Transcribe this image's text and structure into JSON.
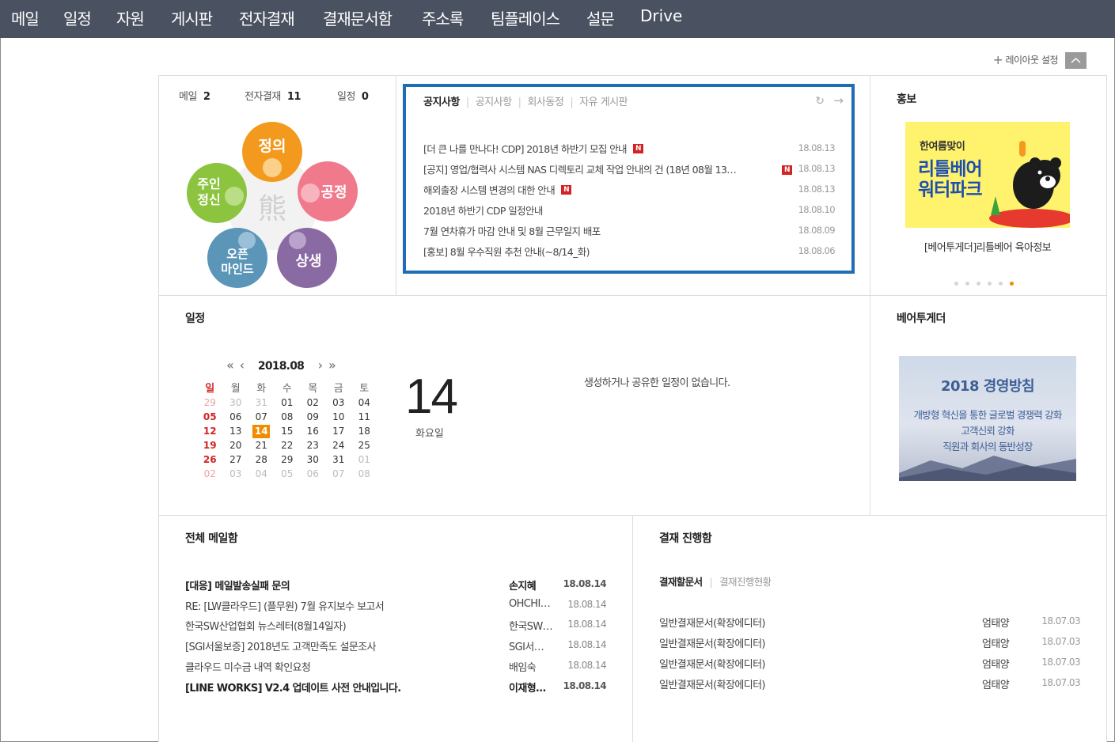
{
  "nav": [
    "메일",
    "일정",
    "자원",
    "게시판",
    "전자결재",
    "결재문서함",
    "주소록",
    "팀플레이스",
    "설문",
    "Drive"
  ],
  "layout_setting": "레이아웃 설정",
  "summary": [
    {
      "label": "메일",
      "count": "2"
    },
    {
      "label": "전자결재",
      "count": "11"
    },
    {
      "label": "일정",
      "count": "0"
    }
  ],
  "values": {
    "top": "정의",
    "left_line1": "주인",
    "left_line2": "정신",
    "right": "공정",
    "bottom_left_line1": "오픈",
    "bottom_left_line2": "마인드",
    "bottom_right": "상생",
    "center_logo": "熊"
  },
  "notice": {
    "tabs": [
      "공지사항",
      "공지사항",
      "회사동정",
      "자유 게시판"
    ],
    "badge": "N",
    "items": [
      {
        "title": "[더 큰 나를 만나다! CDP] 2018년 하반기 모집 안내",
        "date": "18.08.13",
        "new": true
      },
      {
        "title": "[공지] 영업/협력사 시스템 NAS 디렉토리 교체 작업 안내의 건 (18년 08월 13…",
        "date": "18.08.13",
        "new": true
      },
      {
        "title": "해외출장 시스템 변경의 대한 안내",
        "date": "18.08.13",
        "new": true
      },
      {
        "title": "2018년 하반기 CDP 일정안내",
        "date": "18.08.10",
        "new": false
      },
      {
        "title": "7월 연차휴가 마감 안내 및 8월 근무일지 배포",
        "date": "18.08.09",
        "new": false
      },
      {
        "title": "[홍보] 8월 우수직원 추천 안내(~8/14_화)",
        "date": "18.08.06",
        "new": false
      }
    ]
  },
  "promo": {
    "title": "홍보",
    "img_line1": "한여름맞이",
    "img_line2": "리틀베어",
    "img_line3": "워터파크",
    "caption": "[베어투게더]리틀베어 육아정보",
    "dots": 6,
    "active_dot": 5
  },
  "schedule": {
    "title": "일정",
    "month": "2018.08",
    "weekdays": [
      "일",
      "월",
      "화",
      "수",
      "목",
      "금",
      "토"
    ],
    "weeks": [
      [
        "29",
        "30",
        "31",
        "01",
        "02",
        "03",
        "04"
      ],
      [
        "05",
        "06",
        "07",
        "08",
        "09",
        "10",
        "11"
      ],
      [
        "12",
        "13",
        "14",
        "15",
        "16",
        "17",
        "18"
      ],
      [
        "19",
        "20",
        "21",
        "22",
        "23",
        "24",
        "25"
      ],
      [
        "26",
        "27",
        "28",
        "29",
        "30",
        "31",
        "01"
      ],
      [
        "02",
        "03",
        "04",
        "05",
        "06",
        "07",
        "08"
      ]
    ],
    "today": "14",
    "day_name": "화요일",
    "empty_message": "생성하거나 공유한 일정이 없습니다."
  },
  "bear_together": {
    "title": "베어투게더",
    "banner_title": "2018 경영방침",
    "lines": [
      "개방형 혁신을 통한 글로벌 경쟁력 강화",
      "고객신뢰 강화",
      "직원과 회사의 동반성장"
    ]
  },
  "mail": {
    "title": "전체 메일함",
    "items": [
      {
        "subject": "[대응] 메일발송실패 문의",
        "from": "손지혜",
        "date": "18.08.14",
        "unread": true
      },
      {
        "subject": "RE: [LW클라우드] (플무원) 7월 유지보수 보고서",
        "from": "OHCHI…",
        "date": "18.08.14",
        "unread": false
      },
      {
        "subject": "한국SW산업협회 뉴스레터(8월14일자)",
        "from": "한국SW…",
        "date": "18.08.14",
        "unread": false
      },
      {
        "subject": "[SGI서울보증] 2018년도 고객만족도 설문조사",
        "from": "SGI서…",
        "date": "18.08.14",
        "unread": false
      },
      {
        "subject": "클라우드 미수금 내역 확인요청",
        "from": "배임숙",
        "date": "18.08.14",
        "unread": false
      },
      {
        "subject": "[LINE WORKS] V2.4 업데이트 사전 안내입니다.",
        "from": "이재형…",
        "date": "18.08.14",
        "unread": true
      }
    ]
  },
  "approval": {
    "title": "결재 진행함",
    "tabs": [
      "결재할문서",
      "결재진행현황"
    ],
    "items": [
      {
        "doc": "일반결재문서(확장에디터)",
        "user": "엄태양",
        "date": "18.07.03"
      },
      {
        "doc": "일반결재문서(확장에디터)",
        "user": "엄태양",
        "date": "18.07.03"
      },
      {
        "doc": "일반결재문서(확장에디터)",
        "user": "엄태양",
        "date": "18.07.03"
      },
      {
        "doc": "일반결재문서(확장에디터)",
        "user": "엄태양",
        "date": "18.07.03"
      }
    ]
  },
  "colors": {
    "nav_bg": "#4a5160",
    "accent_blue": "#1f6db6",
    "today_orange": "#f08c00",
    "badge_red": "#d32323"
  }
}
